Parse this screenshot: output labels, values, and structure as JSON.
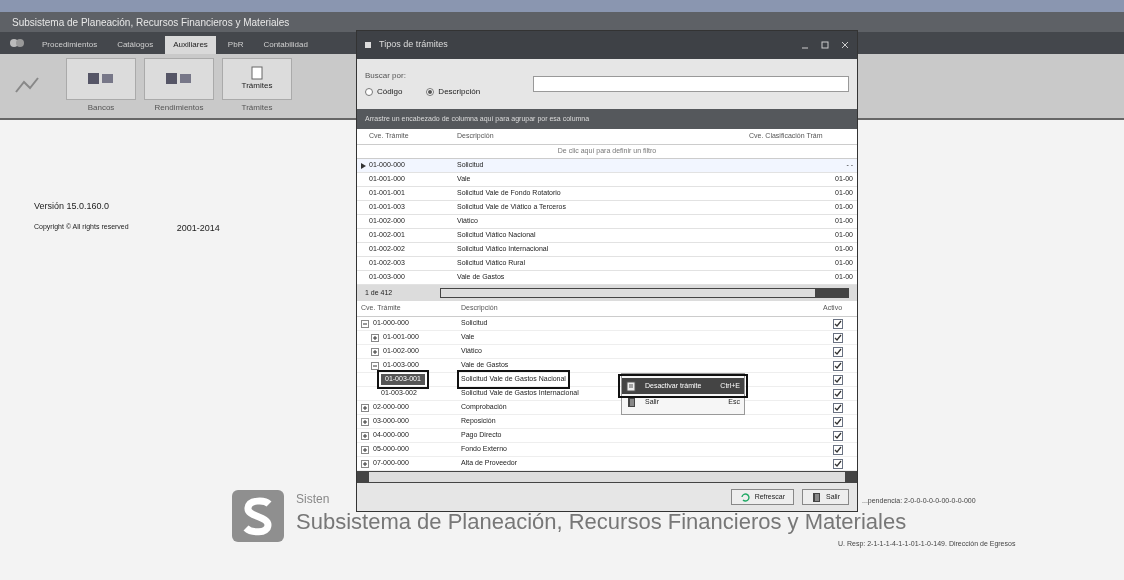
{
  "app": {
    "subtitle": "Subsistema de Planeación, Recursos Financieros y Materiales",
    "tabs": [
      {
        "label": "Procedimientos",
        "selected": false
      },
      {
        "label": "Catálogos",
        "selected": false
      },
      {
        "label": "Auxiliares",
        "selected": true
      },
      {
        "label": "PbR",
        "selected": false
      },
      {
        "label": "Contabilidad",
        "selected": false
      }
    ],
    "ribbon_groups": [
      {
        "label": "Bancos"
      },
      {
        "label": "Rendimientos"
      },
      {
        "label": "Trámites",
        "button": "Trámites"
      }
    ]
  },
  "splash": {
    "version": "Versión 15.0.160.0",
    "copyright": "Copyright © All rights reserved",
    "years": "2001-2014",
    "system_partial": "Sisten",
    "system_name": "Subsistema de Planeación, Recursos Financieros y Materiales",
    "dependencia": "...pendencia: 2-0-0-0-0-0-00-0-0-000",
    "unidad": "U. Resp: 2-1-1-1-4-1-1-01-1-0-149. Dirección de Egresos"
  },
  "dialog": {
    "title": "Tipos de trámites",
    "search": {
      "label": "Buscar por:",
      "options": [
        {
          "label": "Código",
          "selected": false
        },
        {
          "label": "Descripción",
          "selected": true
        }
      ]
    },
    "group_hint": "Arrastre un encabezado de columna aquí para agrupar por esa columna",
    "grid": {
      "columns": [
        "Cve. Trámite",
        "Descripción",
        "Cve. Clasificación Trám"
      ],
      "filter_hint": "De clic aquí para definir un filtro",
      "rows": [
        {
          "cve": "01-000-000",
          "desc": "Solicitud",
          "clasif": "- -",
          "selected": true
        },
        {
          "cve": "01-001-000",
          "desc": "Vale",
          "clasif": "01-00",
          "selected": false
        },
        {
          "cve": "01-001-001",
          "desc": "Solicitud Vale de Fondo Rotatorio",
          "clasif": "01-00",
          "selected": false
        },
        {
          "cve": "01-001-003",
          "desc": "Solicitud Vale de Viático a Terceros",
          "clasif": "01-00",
          "selected": false
        },
        {
          "cve": "01-002-000",
          "desc": "Viático",
          "clasif": "01-00",
          "selected": false
        },
        {
          "cve": "01-002-001",
          "desc": "Solicitud Viático Nacional",
          "clasif": "01-00",
          "selected": false
        },
        {
          "cve": "01-002-002",
          "desc": "Solicitud Viático Internacional",
          "clasif": "01-00",
          "selected": false
        },
        {
          "cve": "01-002-003",
          "desc": "Solicitud Viático Rural",
          "clasif": "01-00",
          "selected": false
        },
        {
          "cve": "01-003-000",
          "desc": "Vale de Gastos",
          "clasif": "01-00",
          "selected": false
        }
      ],
      "pager": "1 de 412"
    },
    "tree": {
      "columns": [
        "Cve. Trámite",
        "Descripción",
        "Activo"
      ],
      "rows": [
        {
          "cve": "01-000-000",
          "desc": "Solicitud",
          "checked": true,
          "selected": false,
          "expanded": true,
          "children": [
            {
              "cve": "01-001-000",
              "desc": "Vale",
              "checked": true,
              "selected": false,
              "expanded": false
            },
            {
              "cve": "01-002-000",
              "desc": "Viático",
              "checked": true,
              "selected": false,
              "expanded": false
            },
            {
              "cve": "01-003-000",
              "desc": "Vale de Gastos",
              "checked": true,
              "selected": false,
              "expanded": true,
              "children": [
                {
                  "cve": "01-003-001",
                  "desc": "Solicitud Vale de Gastos Nacional",
                  "checked": true,
                  "selected": true
                },
                {
                  "cve": "01-003-002",
                  "desc": "Solicitud Vale de Gastos Internacional",
                  "checked": true,
                  "selected": false
                }
              ]
            }
          ]
        },
        {
          "cve": "02-000-000",
          "desc": "Comprobación",
          "checked": true,
          "selected": false,
          "expanded": false
        },
        {
          "cve": "03-000-000",
          "desc": "Reposición",
          "checked": true,
          "selected": false,
          "expanded": false
        },
        {
          "cve": "04-000-000",
          "desc": "Pago Directo",
          "checked": true,
          "selected": false,
          "expanded": false
        },
        {
          "cve": "05-000-000",
          "desc": "Fondo Externo",
          "checked": true,
          "selected": false,
          "expanded": false
        },
        {
          "cve": "07-000-000",
          "desc": "Alta de Proveedor",
          "checked": true,
          "selected": false,
          "expanded": false
        }
      ]
    },
    "context_menu": [
      {
        "label": "Desactivar trámite",
        "shortcut": "Ctrl+E",
        "kind": "lock"
      },
      {
        "label": "Salir",
        "shortcut": "Esc",
        "kind": "exit"
      }
    ],
    "buttons": [
      {
        "label": "Refrescar",
        "kind": "refresh"
      },
      {
        "label": "Salir",
        "kind": "exit"
      }
    ]
  }
}
